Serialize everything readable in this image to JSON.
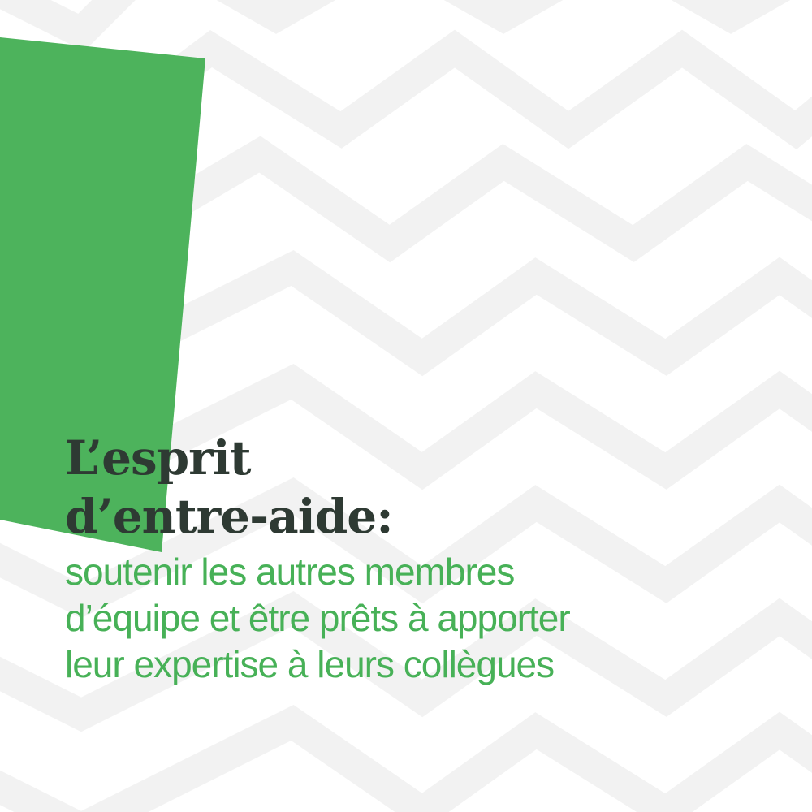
{
  "colors": {
    "background": "#ffffff",
    "zigzag": "#f2f2f2",
    "accent_green": "#4db35c",
    "headline_text": "#2e3a33",
    "subline_text": "#47b157"
  },
  "headline": {
    "line1": "L’esprit",
    "line2": "d’entre-aide:"
  },
  "subline": {
    "line1": "soutenir les autres membres",
    "line2": "d’équipe et être prêts à apporter",
    "line3": "leur expertise à leurs collègues"
  }
}
